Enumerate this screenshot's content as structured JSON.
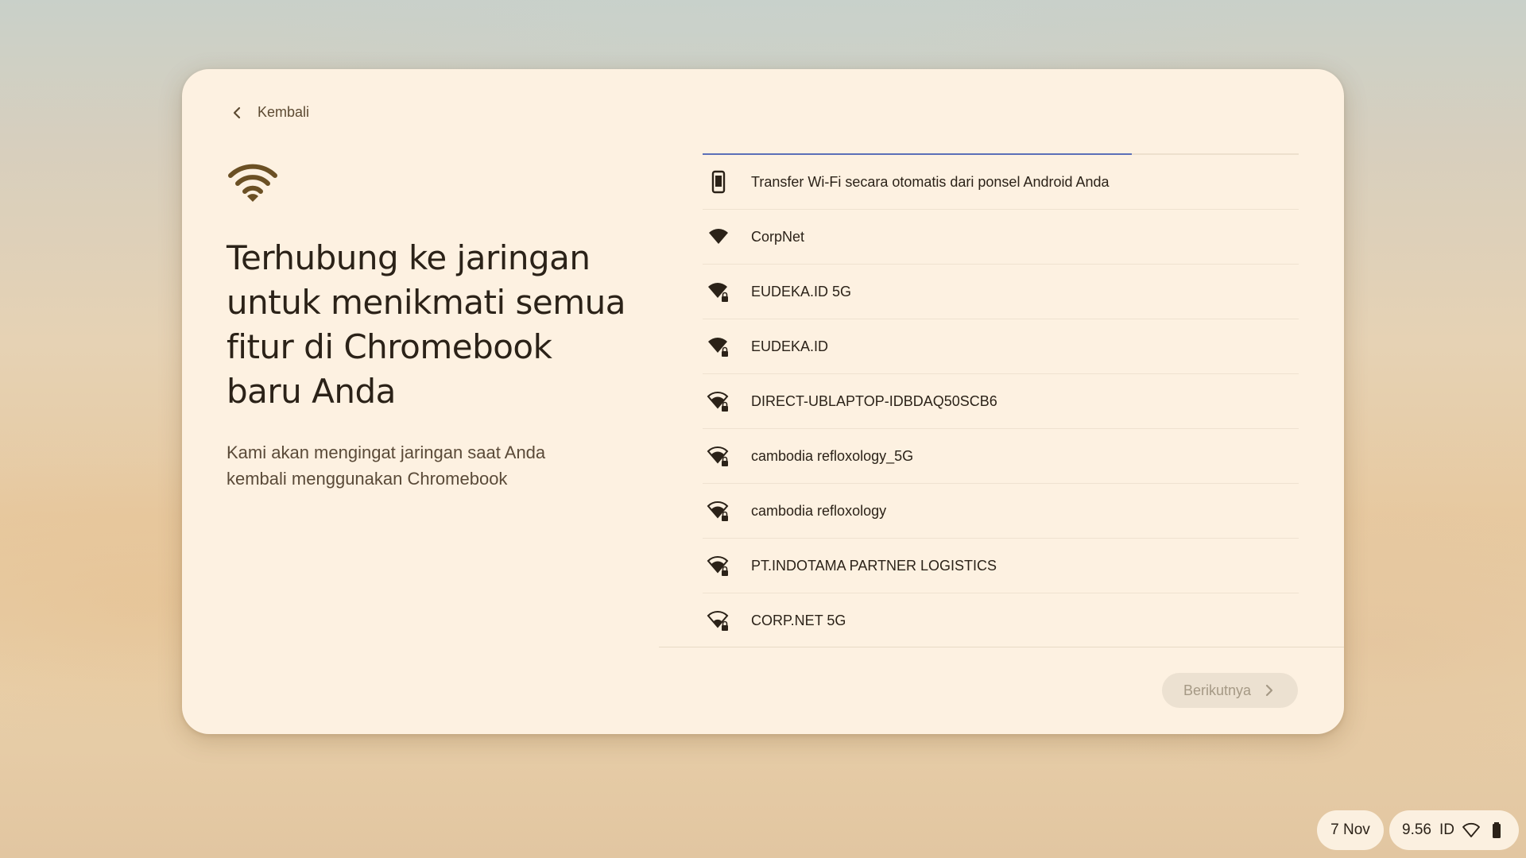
{
  "dialog": {
    "back_label": "Kembali",
    "title": "Terhubung ke jaringan untuk menikmati semua fitur di Chromebook baru Anda",
    "subtitle": "Kami akan mengingat jaringan saat Anda kembali menggunakan Chromebook",
    "progress_fraction": 0.72,
    "networks": [
      {
        "label": "Transfer Wi-Fi secara otomatis dari ponsel Android Anda",
        "icon": "phone-icon",
        "secured": false
      },
      {
        "label": "CorpNet",
        "icon": "wifi-icon",
        "secured": false
      },
      {
        "label": "EUDEKA.ID 5G",
        "icon": "wifi-lock-icon",
        "secured": true
      },
      {
        "label": "EUDEKA.ID",
        "icon": "wifi-lock-icon",
        "secured": true
      },
      {
        "label": "DIRECT-UBLAPTOP-IDBDAQ50SCB6",
        "icon": "wifi-lock-icon",
        "secured": true
      },
      {
        "label": "cambodia refloxology_5G",
        "icon": "wifi-lock-icon",
        "secured": true
      },
      {
        "label": "cambodia refloxology",
        "icon": "wifi-lock-icon",
        "secured": true
      },
      {
        "label": "PT.INDOTAMA PARTNER LOGISTICS",
        "icon": "wifi-lock-icon",
        "secured": true
      },
      {
        "label": "CORP.NET 5G",
        "icon": "wifi-lock-icon",
        "secured": true
      }
    ],
    "next_label": "Berikutnya"
  },
  "shelf": {
    "date": "7 Nov",
    "time": "9.56",
    "ime": "ID",
    "status_icons": [
      "wifi-icon",
      "battery-icon"
    ]
  },
  "colors": {
    "dialog_bg": "#fdf1e1",
    "accent": "#5b6fb8",
    "text": "#2b2218",
    "icon": "#6b5024"
  }
}
